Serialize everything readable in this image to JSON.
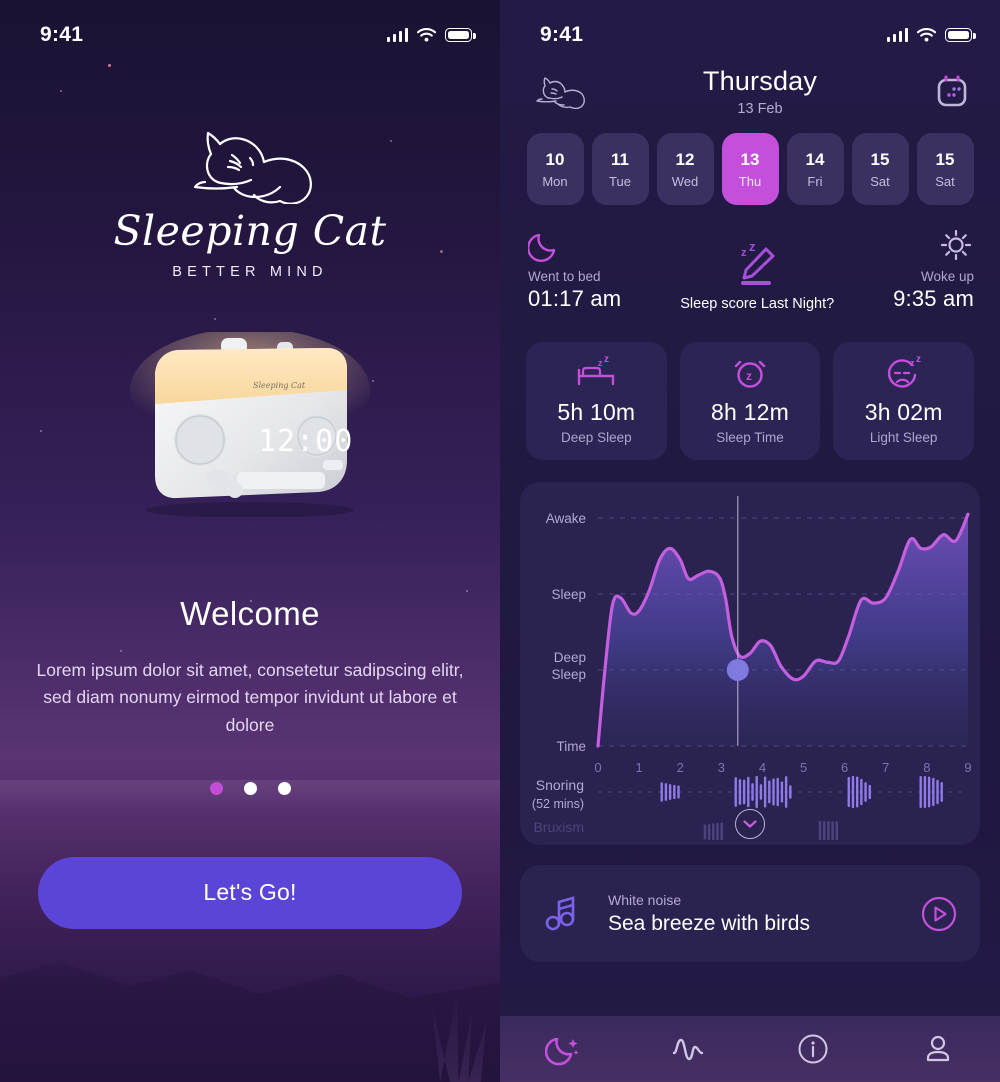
{
  "left_screen": {
    "status_bar": {
      "time": "9:41",
      "signal_icon": "signal-bars-icon",
      "wifi_icon": "wifi-icon",
      "battery_icon": "battery-icon"
    },
    "logo": {
      "icon": "sleeping-cat-logo-icon",
      "wordmark": "Sleeping Cat",
      "tagline": "BETTER MIND"
    },
    "device": {
      "icon": "sunrise-alarm-clock-device",
      "display_time": "12:00",
      "brand_label": "Sleeping Cat"
    },
    "welcome": {
      "heading": "Welcome",
      "body": "Lorem ipsum dolor sit amet, consetetur sadipscing elitr, sed diam nonumy eirmod tempor invidunt ut labore et dolore"
    },
    "pagination": {
      "total": 3,
      "active_index": 0
    },
    "cta": {
      "label": "Let's Go!",
      "color": "#5b45d6"
    }
  },
  "right_screen": {
    "status_bar": {
      "time": "9:41",
      "signal_icon": "signal-bars-icon",
      "wifi_icon": "wifi-icon",
      "battery_icon": "battery-icon"
    },
    "header": {
      "left_icon": "sleeping-cat-icon",
      "day": "Thursday",
      "date": "13 Feb",
      "right_icon": "calendar-icon"
    },
    "day_strip": [
      {
        "num": "10",
        "weekday": "Mon",
        "active": false
      },
      {
        "num": "11",
        "weekday": "Tue",
        "active": false
      },
      {
        "num": "12",
        "weekday": "Wed",
        "active": false
      },
      {
        "num": "13",
        "weekday": "Thu",
        "active": true
      },
      {
        "num": "14",
        "weekday": "Fri",
        "active": false
      },
      {
        "num": "15",
        "weekday": "Sat",
        "active": false
      },
      {
        "num": "15",
        "weekday": "Sat",
        "active": false
      }
    ],
    "bed_row": {
      "went_to_bed": {
        "icon": "moon-icon",
        "label": "Went to bed",
        "value": "01:17 am"
      },
      "sleep_score": {
        "icon": "sleep-score-pencil-icon",
        "label": "Sleep score Last Night?"
      },
      "woke_up": {
        "icon": "sun-icon",
        "label": "Woke up",
        "value": "9:35 am"
      }
    },
    "stats": [
      {
        "icon": "bed-zz-icon",
        "value": "5h 10m",
        "caption": "Deep Sleep"
      },
      {
        "icon": "alarm-clock-z-icon",
        "value": "8h 12m",
        "caption": "Sleep Time"
      },
      {
        "icon": "sleepy-face-icon",
        "value": "3h 02m",
        "caption": "Light Sleep"
      }
    ],
    "snoring": {
      "label": "Snoring",
      "sublabel": "(52 mins)"
    },
    "bruxism": {
      "label": "Bruxism"
    },
    "expand_button": {
      "icon": "chevron-down-icon"
    },
    "sound_card": {
      "icon": "music-notes-icon",
      "kicker": "White noise",
      "title": "Sea breeze with birds",
      "play_icon": "play-circle-icon"
    },
    "tab_bar": [
      {
        "icon": "moon-stars-icon",
        "name": "sleep",
        "active": true
      },
      {
        "icon": "pulse-wave-icon",
        "name": "stats",
        "active": false
      },
      {
        "icon": "info-circle-icon",
        "name": "info",
        "active": false
      },
      {
        "icon": "person-icon",
        "name": "profile",
        "active": false
      }
    ],
    "accent_colors": {
      "magenta": "#c44fdb",
      "violet": "#8a6ff0",
      "card": "#2a2350",
      "background": "#211a42"
    }
  },
  "chart_data": {
    "type": "area",
    "title": "",
    "xlabel": "",
    "ylabel": "",
    "x_ticks": [
      "0",
      "1",
      "2",
      "3",
      "4",
      "5",
      "6",
      "7",
      "8",
      "9"
    ],
    "y_labels": [
      "Awake",
      "Sleep",
      "Deep Sleep",
      "Time"
    ],
    "y_values": [
      4,
      3,
      2,
      1
    ],
    "xlim": [
      0,
      9
    ],
    "grid": true,
    "legend": "none",
    "line_color": "#c45fe0",
    "marker": {
      "x": 3.4,
      "y": 2,
      "color": "#7f7ae0",
      "label": ""
    },
    "x": [
      0,
      0.15,
      0.35,
      0.55,
      0.8,
      1.0,
      1.25,
      1.5,
      1.75,
      2.0,
      2.2,
      2.45,
      2.7,
      2.95,
      3.1,
      3.25,
      3.45,
      3.7,
      3.95,
      4.2,
      4.45,
      4.75,
      5.0,
      5.3,
      5.6,
      5.85,
      6.1,
      6.4,
      6.7,
      7.0,
      7.3,
      7.6,
      7.85,
      8.1,
      8.4,
      8.7,
      9.0
    ],
    "y": [
      1.0,
      1.9,
      2.85,
      2.95,
      2.75,
      2.78,
      3.05,
      3.45,
      3.6,
      3.45,
      3.2,
      3.25,
      3.3,
      3.22,
      2.95,
      2.45,
      2.18,
      2.22,
      2.38,
      2.32,
      2.05,
      1.88,
      1.92,
      2.12,
      2.1,
      2.12,
      2.45,
      2.92,
      2.88,
      2.95,
      3.3,
      3.72,
      3.6,
      3.62,
      3.78,
      3.7,
      4.05
    ],
    "snoring_bursts": [
      {
        "start": 1.55,
        "end": 2.05
      },
      {
        "start": 3.35,
        "end": 4.75
      },
      {
        "start": 6.1,
        "end": 6.7
      },
      {
        "start": 7.85,
        "end": 8.4
      }
    ],
    "snoring_total_minutes": 52
  }
}
